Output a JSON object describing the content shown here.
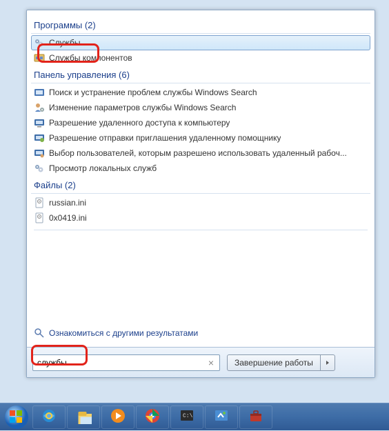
{
  "sections": {
    "programs": {
      "header": "Программы (2)"
    },
    "control_panel": {
      "header": "Панель управления (6)"
    },
    "files": {
      "header": "Файлы (2)"
    }
  },
  "programs": [
    {
      "label": "Службы",
      "icon": "services-icon",
      "selected": true
    },
    {
      "label": "Службы компонентов",
      "icon": "component-services-icon"
    }
  ],
  "control_panel": [
    {
      "label": "Поиск и устранение проблем службы Windows Search",
      "icon": "troubleshoot-icon"
    },
    {
      "label": "Изменение параметров службы Windows Search",
      "icon": "user-setting-icon"
    },
    {
      "label": "Разрешение удаленного доступа к компьютеру",
      "icon": "remote-access-icon"
    },
    {
      "label": "Разрешение отправки приглашения удаленному помощнику",
      "icon": "remote-assist-icon"
    },
    {
      "label": "Выбор пользователей, которым разрешено использовать удаленный рабоч...",
      "icon": "remote-users-icon"
    },
    {
      "label": "Просмотр локальных служб",
      "icon": "services-icon"
    }
  ],
  "files": [
    {
      "label": "russian.ini",
      "icon": "ini-file-icon"
    },
    {
      "label": "0x0419.ini",
      "icon": "ini-file-icon"
    }
  ],
  "more_results": "Ознакомиться с другими результатами",
  "search": {
    "value": "службы"
  },
  "shutdown": {
    "label": "Завершение работы"
  },
  "taskbar": [
    "internet-explorer-icon",
    "file-explorer-icon",
    "media-player-icon",
    "chrome-icon",
    "terminal-icon",
    "tool1-icon",
    "toolbox-icon"
  ]
}
